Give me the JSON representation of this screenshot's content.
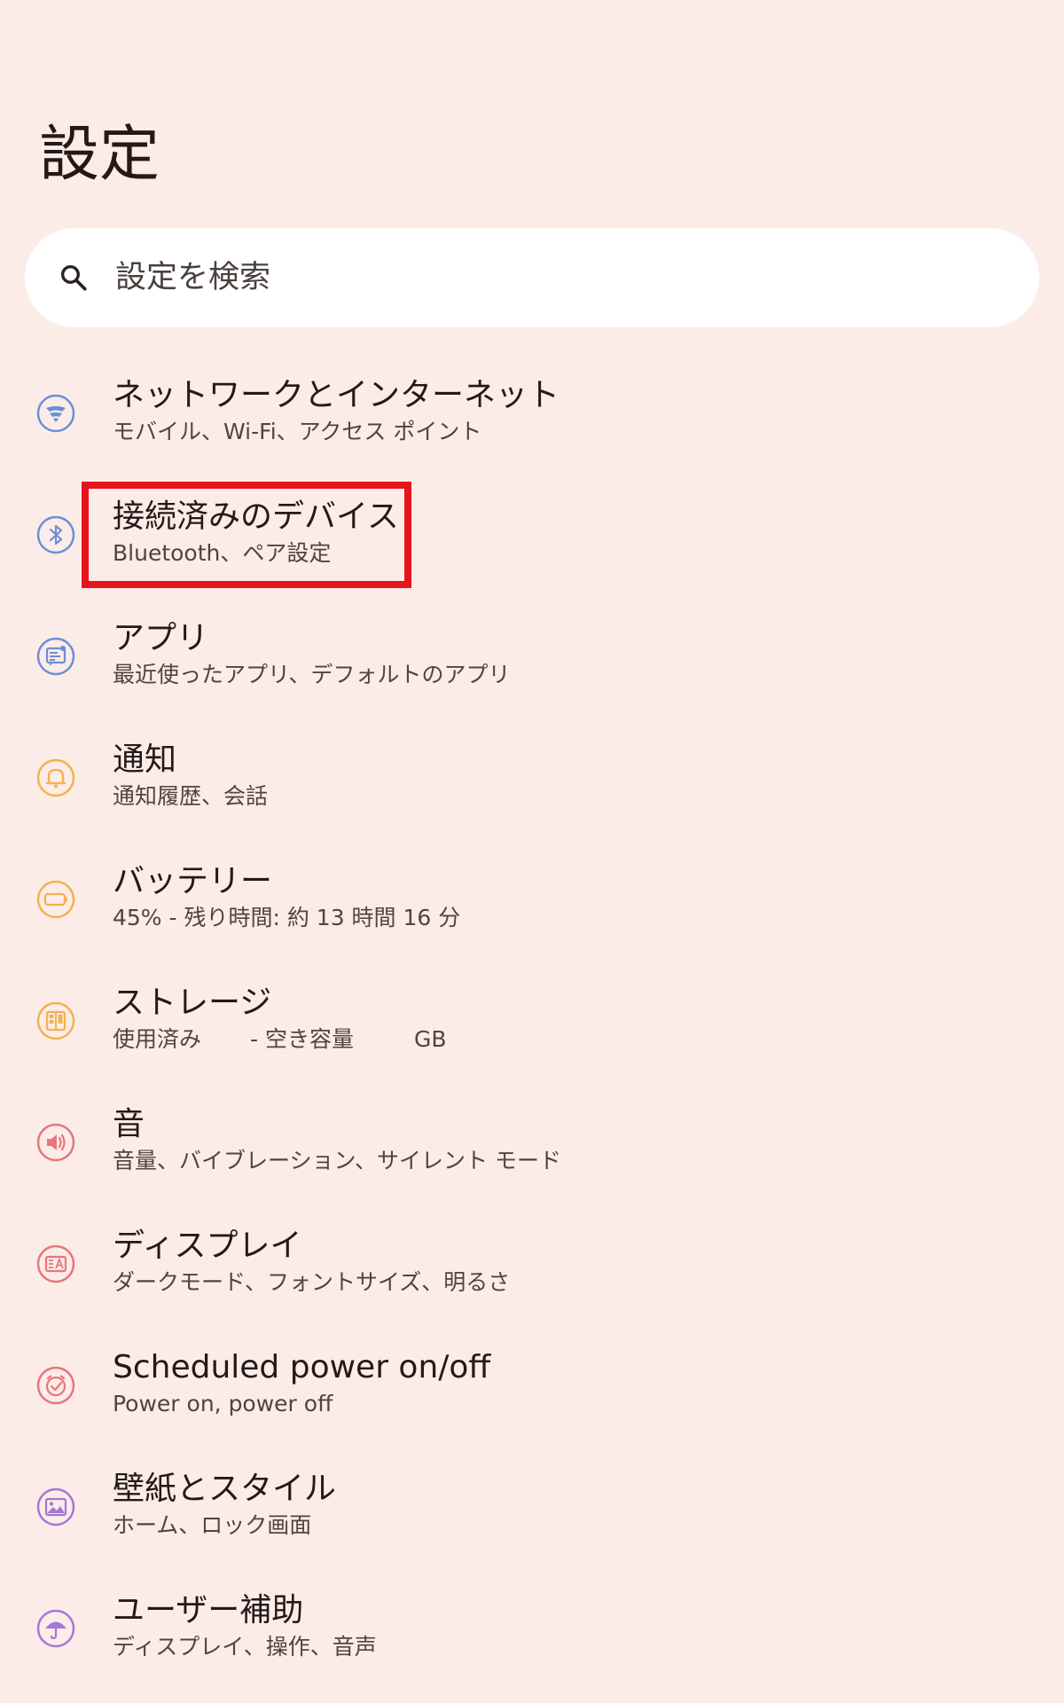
{
  "header": {
    "title": "設定"
  },
  "search": {
    "placeholder": "設定を検索",
    "icon": "search-icon"
  },
  "colors": {
    "background": "#FCECE8",
    "network": "#6C8FD8",
    "bluetooth": "#6C8FD8",
    "apps": "#6C8FD8",
    "notifications": "#F2B24E",
    "battery": "#F2B24E",
    "storage": "#F2B24E",
    "sound": "#E8757C",
    "display": "#E8757C",
    "scheduled_power": "#E8757C",
    "wallpaper": "#A478D8",
    "accessibility": "#A478D8",
    "highlight": "#E8141C"
  },
  "settings_items": [
    {
      "title": "ネットワークとインターネット",
      "subtitle": "モバイル、Wi-Fi、アクセス ポイント",
      "icon": "network-icon"
    },
    {
      "title": "接続済みのデバイス",
      "subtitle": "Bluetooth、ペア設定",
      "icon": "bluetooth-icon",
      "highlighted": true
    },
    {
      "title": "アプリ",
      "subtitle": "最近使ったアプリ、デフォルトのアプリ",
      "icon": "apps-icon"
    },
    {
      "title": "通知",
      "subtitle": "通知履歴、会話",
      "icon": "bell-icon"
    },
    {
      "title": "バッテリー",
      "subtitle": "45% - 残り時間: 約 13 時間 16 分",
      "icon": "battery-icon"
    },
    {
      "title": "ストレージ",
      "subtitle_parts": [
        "使用済み",
        "- 空き容量",
        "GB"
      ],
      "icon": "storage-icon"
    },
    {
      "title": "音",
      "subtitle": "音量、バイブレーション、サイレント モード",
      "icon": "speaker-icon"
    },
    {
      "title": "ディスプレイ",
      "subtitle": "ダークモード、フォントサイズ、明るさ",
      "icon": "display-icon"
    },
    {
      "title": "Scheduled power on/off",
      "subtitle": "Power on, power off",
      "icon": "clock-icon"
    },
    {
      "title": "壁紙とスタイル",
      "subtitle": "ホーム、ロック画面",
      "icon": "wallpaper-icon"
    },
    {
      "title": "ユーザー補助",
      "subtitle": "ディスプレイ、操作、音声",
      "icon": "umbrella-icon"
    }
  ]
}
